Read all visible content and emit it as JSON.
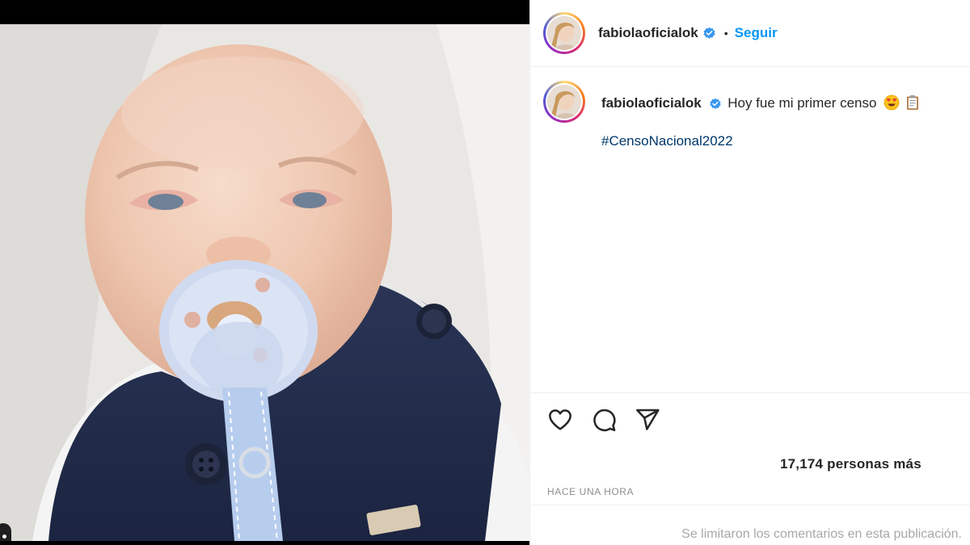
{
  "post": {
    "username": "fabiolaoficialok",
    "follow_label": "Seguir",
    "separator": "•",
    "caption": "Hoy fue mi primer censo",
    "hashtag": "#CensoNacional2022",
    "likes_text": "17,174 personas más",
    "time_ago": "HACE UNA HORA",
    "comments_notice": "Se limitaron los comentarios en esta publicación."
  },
  "icons": {
    "verified": "verified-badge-icon",
    "like": "heart-icon",
    "comment": "comment-bubble-icon",
    "share": "paper-plane-icon",
    "emoji1": "heart-eyes-emoji",
    "emoji2": "clipboard-emoji"
  },
  "colors": {
    "follow": "#0095f6",
    "hashtag": "#00376b",
    "verified": "#3897f0",
    "muted": "#8e8e8e"
  }
}
